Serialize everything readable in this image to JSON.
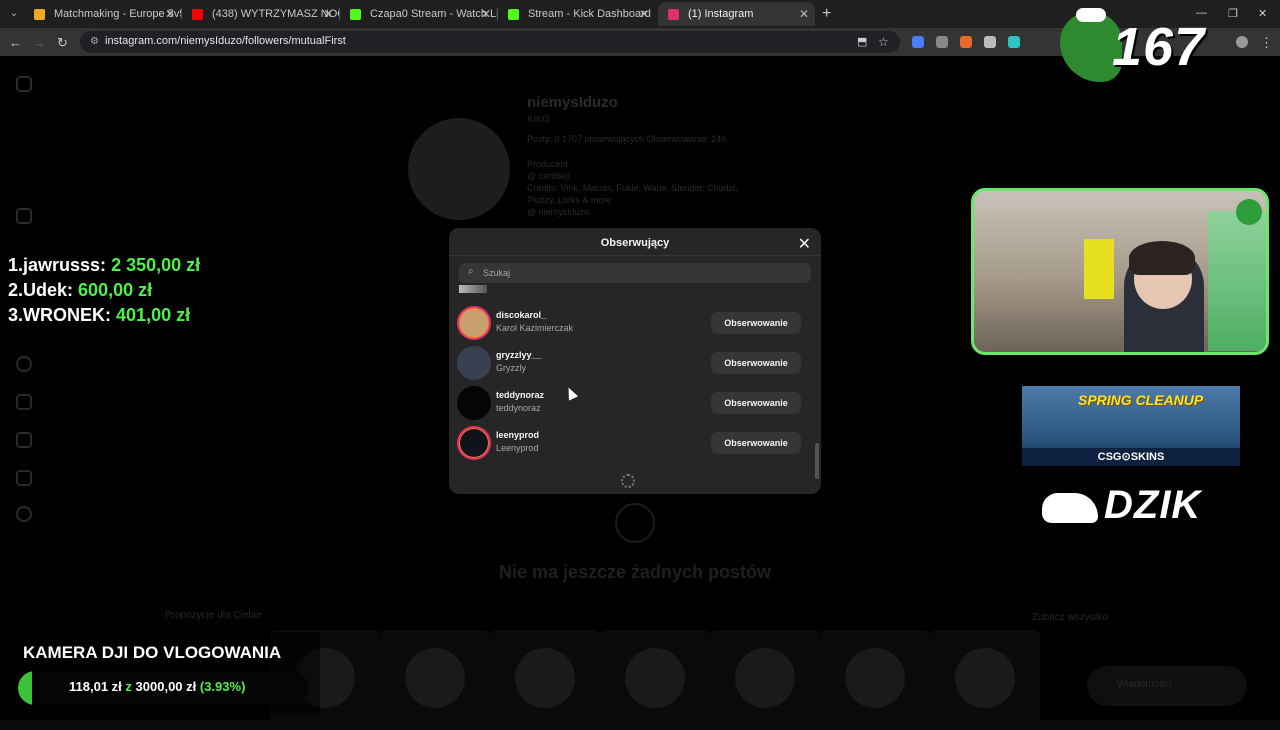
{
  "browser": {
    "tabs": [
      {
        "label": "Matchmaking - Europe 5v5 Qu",
        "favicon_color": "#f5a623"
      },
      {
        "label": "(438) WYTRZYMASZ NOC W TY",
        "favicon_color": "#ff0000"
      },
      {
        "label": "Czapa0 Stream - Watch Live on",
        "favicon_color": "#53fc18"
      },
      {
        "label": "Stream - Kick Dashboard",
        "favicon_color": "#53fc18"
      },
      {
        "label": "(1) Instagram",
        "favicon_color": "#e1306c",
        "active": true
      }
    ],
    "url": "instagram.com/niemysIduzo/followers/mutualFirst"
  },
  "profile": {
    "username": "niemysIduzo",
    "subname": "IUKI3",
    "stats": "Posty: 0    1707 obserwujących    Obserwowanie: 246",
    "bio": "Producent\n@ certified\nCredits: Vink, Macias, Fukie, Wane, Slender, Chudzi, Pluzzy, Lorks & more\n@ niemysIduzo",
    "no_posts": "Nie ma jeszcze żadnych postów",
    "suggestions_label": "Propozycje dla Ciebie",
    "see_all": "Zobacz wszystko",
    "messages": "Wiadomości"
  },
  "modal": {
    "title": "Obserwujący",
    "search_placeholder": "Szukaj",
    "followers": [
      {
        "username": "discokarol_",
        "full_name": "Karol Kazimierczak",
        "button": "Obserwowanie",
        "ring": true
      },
      {
        "username": "gryzzlyy__",
        "full_name": "Gryzzly",
        "button": "Obserwowanie",
        "ring": false
      },
      {
        "username": "teddynoraz",
        "full_name": "teddynoraz",
        "button": "Obserwowanie",
        "ring": false
      },
      {
        "username": "leenyprod",
        "full_name": "Leenyprod",
        "button": "Obserwowanie",
        "ring": true
      }
    ]
  },
  "overlay": {
    "counter": "167",
    "leaderboard": [
      {
        "rank": "1.",
        "name": "jawrusss:",
        "amount": "2 350,00 zł"
      },
      {
        "rank": "2.",
        "name": "Udek:",
        "amount": "600,00 zł"
      },
      {
        "rank": "3.",
        "name": "WRONEK:",
        "amount": "401,00 zł"
      }
    ],
    "sponsor1_headline": "SPRING CLEANUP",
    "sponsor1_brand": "CSG⊙SKINS",
    "sponsor2_brand": "DZIK",
    "goal": {
      "title": "KAMERA DJI DO VLOGOWANIA",
      "current": "118,01 zł",
      "sep": "z",
      "target": "3000,00 zł",
      "percent_text": "(3.93%)",
      "progress": 0.0393
    }
  },
  "colors": {
    "accent_green": "#4ef04a",
    "instagram_ring": "#e1306c"
  }
}
